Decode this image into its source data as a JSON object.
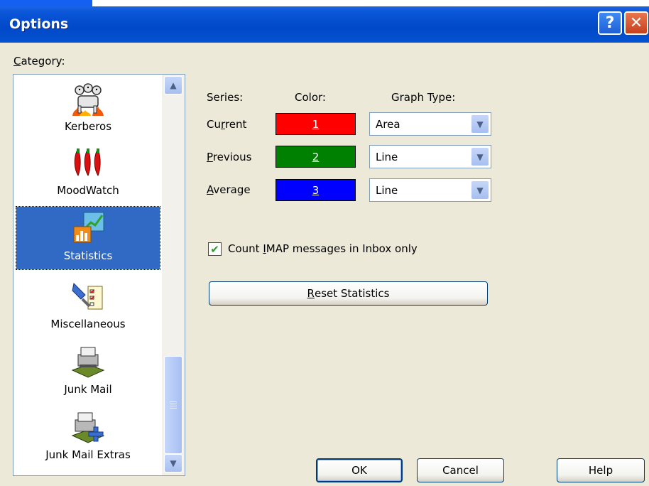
{
  "window": {
    "title": "Options",
    "help_symbol": "?",
    "close_symbol": "✕"
  },
  "category": {
    "label_accel": "C",
    "label_rest": "ategory:",
    "items": [
      {
        "label": "Kerberos",
        "icon": "kerberos-dog-icon"
      },
      {
        "label": "MoodWatch",
        "icon": "chili-peppers-icon"
      },
      {
        "label": "Statistics",
        "icon": "statistics-chart-icon",
        "selected": true
      },
      {
        "label": "Miscellaneous",
        "icon": "miscellaneous-icon"
      },
      {
        "label": "Junk Mail",
        "icon": "junk-mail-icon"
      },
      {
        "label": "Junk Mail Extras",
        "icon": "junk-mail-extras-icon"
      }
    ],
    "scroll_up": "▲",
    "scroll_down": "▼"
  },
  "statistics": {
    "headers": {
      "series": "Series:",
      "color": "Color:",
      "graph_type": "Graph Type:"
    },
    "rows": [
      {
        "pre": "Cu",
        "accel": "r",
        "post": "rent",
        "color_label": "1",
        "color": "#ff0000",
        "graph_type": "Area"
      },
      {
        "pre": "",
        "accel": "P",
        "post": "revious",
        "color_label": "2",
        "color": "#008000",
        "graph_type": "Line"
      },
      {
        "pre": "",
        "accel": "A",
        "post": "verage",
        "color_label": "3",
        "color": "#0000ff",
        "graph_type": "Line"
      }
    ],
    "dropdown_arrow": "▼",
    "checkbox": {
      "checked": true,
      "mark": "✔",
      "pre": "Count ",
      "accel": "I",
      "post": "MAP messages in Inbox only"
    },
    "reset_button": {
      "accel": "R",
      "rest": "eset Statistics"
    }
  },
  "buttons": {
    "ok": "OK",
    "cancel": "Cancel",
    "help": "Help"
  },
  "colors": {
    "title_bar": "#0a55d8",
    "selection": "#316ac5",
    "dialog_bg": "#ece9d8"
  }
}
